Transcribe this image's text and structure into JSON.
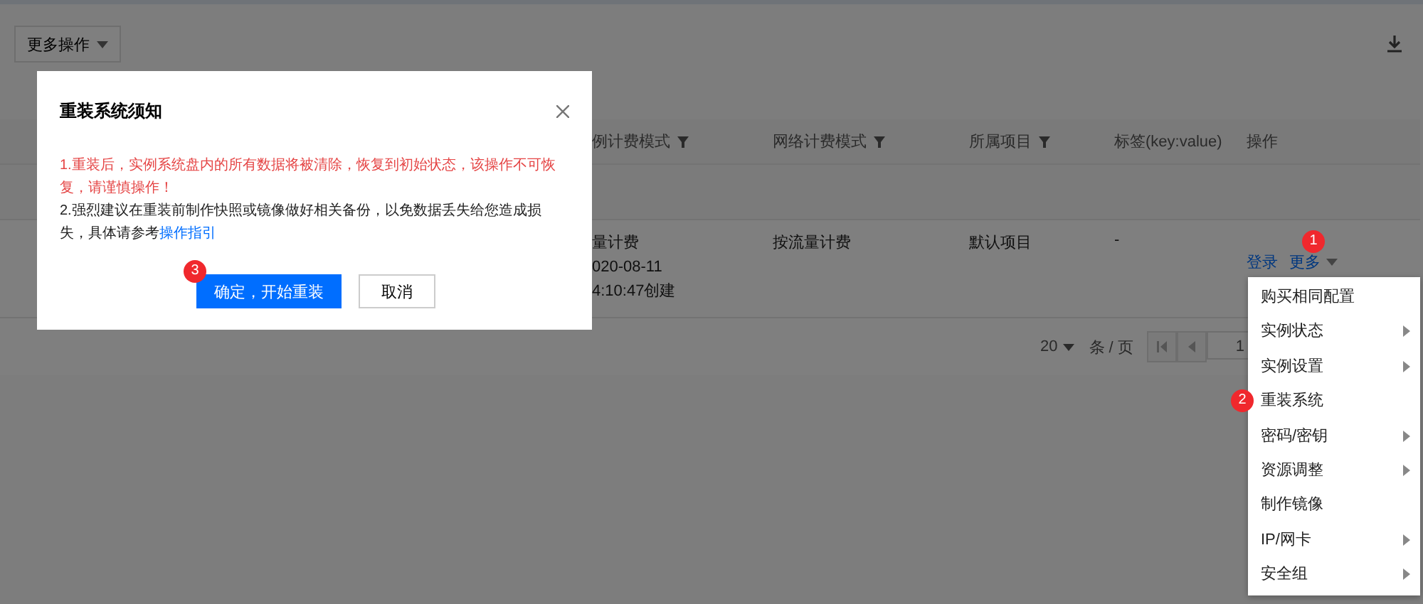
{
  "toolbar": {
    "more_actions": "更多操作"
  },
  "table": {
    "columns": [
      {
        "label": "例计费模式",
        "filter": true
      },
      {
        "label": "网络计费模式",
        "filter": true
      },
      {
        "label": "所属项目",
        "filter": true
      },
      {
        "label": "标签(key:value)",
        "filter": false
      },
      {
        "label": "操作",
        "filter": false
      }
    ],
    "row": {
      "billing": [
        "量计费",
        "020-08-11",
        "4:10:47创建"
      ],
      "network": "按流量计费",
      "project": "默认项目",
      "tags": "-",
      "actions": [
        {
          "label": "登录",
          "dropdown": false
        },
        {
          "label": "更多",
          "dropdown": true,
          "badge": "1"
        }
      ]
    }
  },
  "pagination": {
    "page_size": "20",
    "unit": "条 / 页",
    "page": "1"
  },
  "menu": {
    "items": [
      {
        "label": "购买相同配置",
        "submenu": false
      },
      {
        "label": "实例状态",
        "submenu": true
      },
      {
        "label": "实例设置",
        "submenu": true
      },
      {
        "label": "重装系统",
        "submenu": false,
        "badge": "2"
      },
      {
        "label": "密码/密钥",
        "submenu": true
      },
      {
        "label": "资源调整",
        "submenu": true
      },
      {
        "label": "制作镜像",
        "submenu": false
      },
      {
        "label": "IP/网卡",
        "submenu": true
      },
      {
        "label": "安全组",
        "submenu": true
      }
    ]
  },
  "modal": {
    "title": "重装系统须知",
    "warning": "1.重装后，实例系统盘内的所有数据将被清除，恢复到初始状态，该操作不可恢复，请谨慎操作！",
    "note": "2.强烈建议在重装前制作快照或镜像做好相关备份，以免数据丢失给您造成损失，具体请参考",
    "link": "操作指引",
    "confirm": "确定，开始重装",
    "confirm_badge": "3",
    "cancel": "取消"
  }
}
